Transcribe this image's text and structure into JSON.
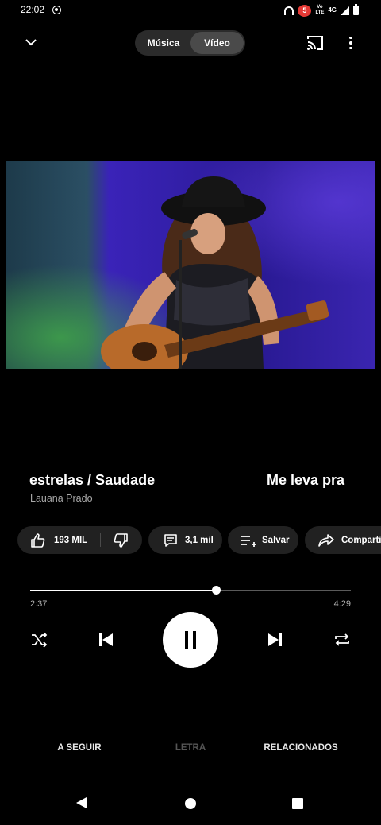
{
  "status_bar": {
    "time": "22:02",
    "badge": "5",
    "volte_top": "Vo",
    "volte_bottom": "LTE",
    "network": "4G",
    "icons": [
      "screen-record-icon",
      "headset-icon",
      "notification-badge-icon",
      "volte-icon",
      "signal-icon",
      "battery-icon"
    ]
  },
  "top_bar": {
    "collapse_icon": "chevron-down-icon",
    "toggle": {
      "music_label": "Música",
      "video_label": "Vídeo",
      "selected": "Vídeo"
    },
    "cast_icon": "cast-icon",
    "more_icon": "more-vertical-icon"
  },
  "video": {
    "description": "live performance thumbnail"
  },
  "track": {
    "title_current": "estrelas / Saudade",
    "title_next": "Me leva pra",
    "artist": "Lauana Prado"
  },
  "actions": {
    "likes": "193 MIL",
    "comments": "3,1 mil",
    "save": "Salvar",
    "share": "Compartilhar"
  },
  "progress": {
    "current": "2:37",
    "total": "4:29",
    "fraction": 0.58
  },
  "controls": {
    "icons": [
      "shuffle-icon",
      "previous-icon",
      "pause-icon",
      "next-icon",
      "repeat-icon"
    ],
    "state": "playing"
  },
  "tabs": [
    {
      "label": "A SEGUIR",
      "active": true
    },
    {
      "label": "LETRA",
      "active": false
    },
    {
      "label": "RELACIONADOS",
      "active": true
    }
  ],
  "colors": {
    "background": "#000000",
    "chip": "#212121",
    "toggle_selected": "#4a4a4a",
    "muted_text": "#a8a8a8",
    "badge": "#e53935"
  }
}
